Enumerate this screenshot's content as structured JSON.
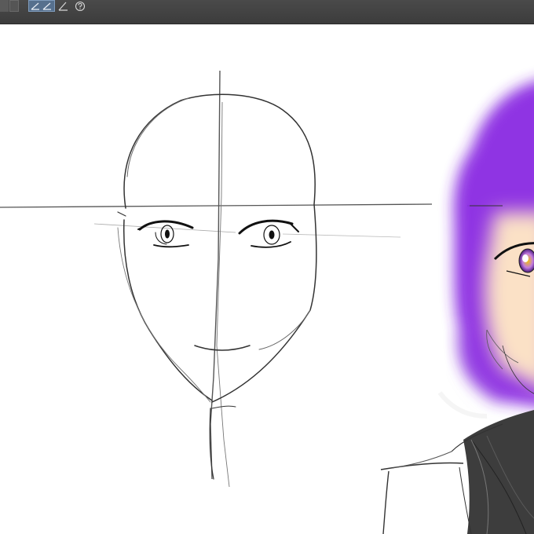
{
  "toolbar": {
    "buttons": [
      {
        "name": "square-tool",
        "icon": "square-icon",
        "state": "normal"
      },
      {
        "name": "square-outline-tool",
        "icon": "square-outline-icon",
        "state": "normal"
      },
      {
        "name": "line-angle-tool",
        "icon": "angle-lines-icon",
        "state": "active"
      },
      {
        "name": "ruler-tool",
        "icon": "ruler-angle-icon",
        "state": "normal"
      },
      {
        "name": "help",
        "icon": "help-icon",
        "state": "normal"
      }
    ],
    "active_color": "#56708e"
  },
  "canvas": {
    "background": "#ffffff",
    "sketch_color": "#333333",
    "hair_color": "#8a2be2",
    "skin_color": "#fbe1c6",
    "eye_color": "#d4a500"
  }
}
